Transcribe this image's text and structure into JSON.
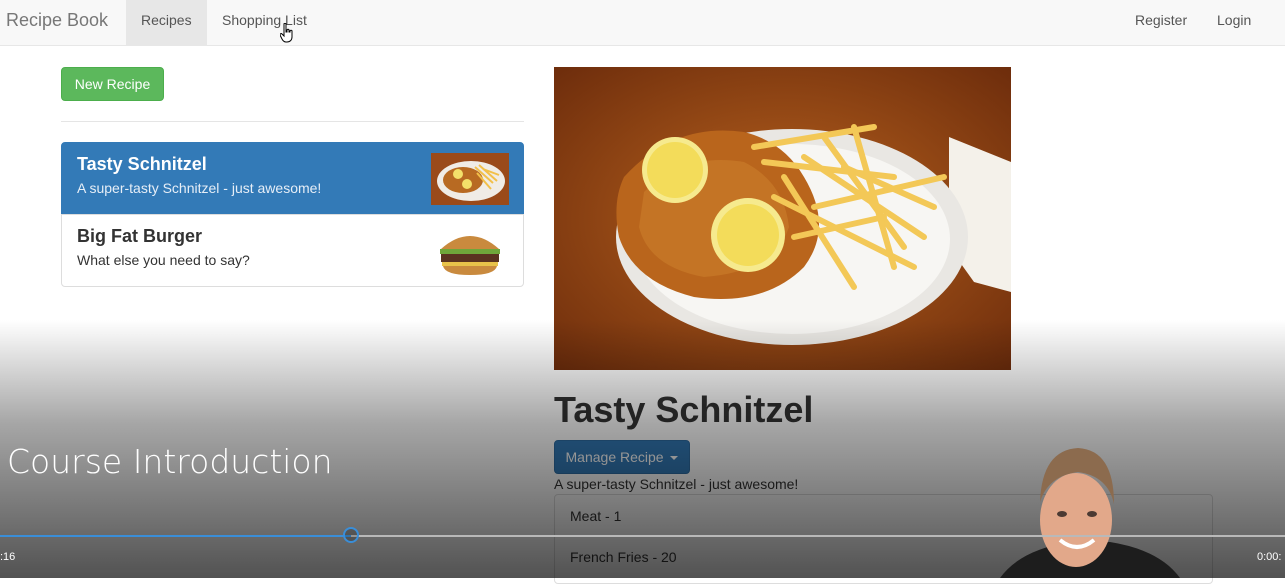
{
  "navbar": {
    "brand": "Recipe Book",
    "links": [
      "Recipes",
      "Shopping List"
    ],
    "right_links": [
      "Register",
      "Login"
    ],
    "active": "Recipes"
  },
  "recipe_list": {
    "new_button": "New Recipe",
    "items": [
      {
        "title": "Tasty Schnitzel",
        "description": "A super-tasty Schnitzel - just awesome!",
        "thumbnail": "schnitzel-thumbnail",
        "selected": true
      },
      {
        "title": "Big Fat Burger",
        "description": "What else you need to say?",
        "thumbnail": "burger-thumbnail",
        "selected": false
      }
    ]
  },
  "recipe_detail": {
    "image": "schnitzel-photo",
    "title": "Tasty Schnitzel",
    "manage_button": "Manage Recipe",
    "description": "A super-tasty Schnitzel - just awesome!",
    "ingredients": [
      "Meat - 1",
      "French Fries - 20"
    ]
  },
  "video_player": {
    "title": "Course Introduction",
    "current_time": ":16",
    "end_time": "0:00:",
    "progress": 0.273,
    "presenter": "presenter-webcam"
  },
  "colors": {
    "primary": "#337ab7",
    "success": "#5cb85c",
    "progress": "#3a8ed8"
  }
}
